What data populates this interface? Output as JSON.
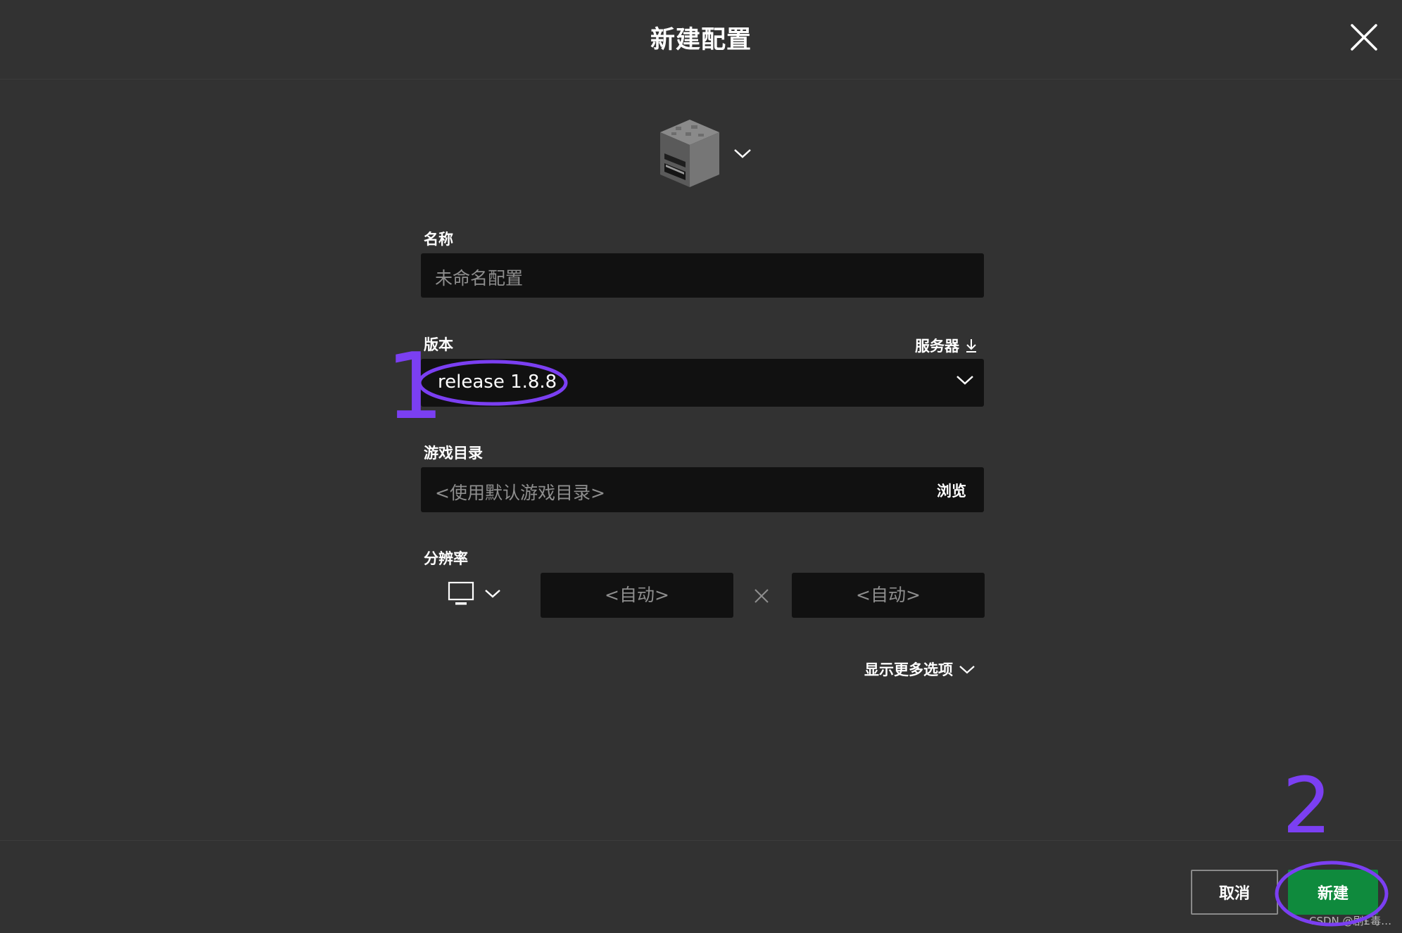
{
  "header": {
    "title": "新建配置"
  },
  "form": {
    "name": {
      "label": "名称",
      "placeholder": "未命名配置"
    },
    "version": {
      "label": "版本",
      "value": "release 1.8.8",
      "server_label": "服务器"
    },
    "game_dir": {
      "label": "游戏目录",
      "placeholder": "<使用默认游戏目录>",
      "browse_label": "浏览"
    },
    "resolution": {
      "label": "分辨率",
      "width_placeholder": "<自动>",
      "height_placeholder": "<自动>"
    },
    "more_options_label": "显示更多选项"
  },
  "footer": {
    "cancel_label": "取消",
    "create_label": "新建"
  },
  "annotations": {
    "step1": "1",
    "step2": "2",
    "color": "#7b3ff2"
  },
  "watermark": "CSDN @剧£毒…",
  "colors": {
    "background": "#323232",
    "input_bg": "#111111",
    "primary_button": "#0f8a3d",
    "text": "#ffffff",
    "placeholder": "#8e8e8e"
  },
  "icons": {
    "profile_icon": "furnace-block-icon",
    "close": "close-icon",
    "dropdown": "chevron-down-icon",
    "download": "download-icon",
    "monitor": "monitor-icon",
    "times": "times-icon"
  }
}
